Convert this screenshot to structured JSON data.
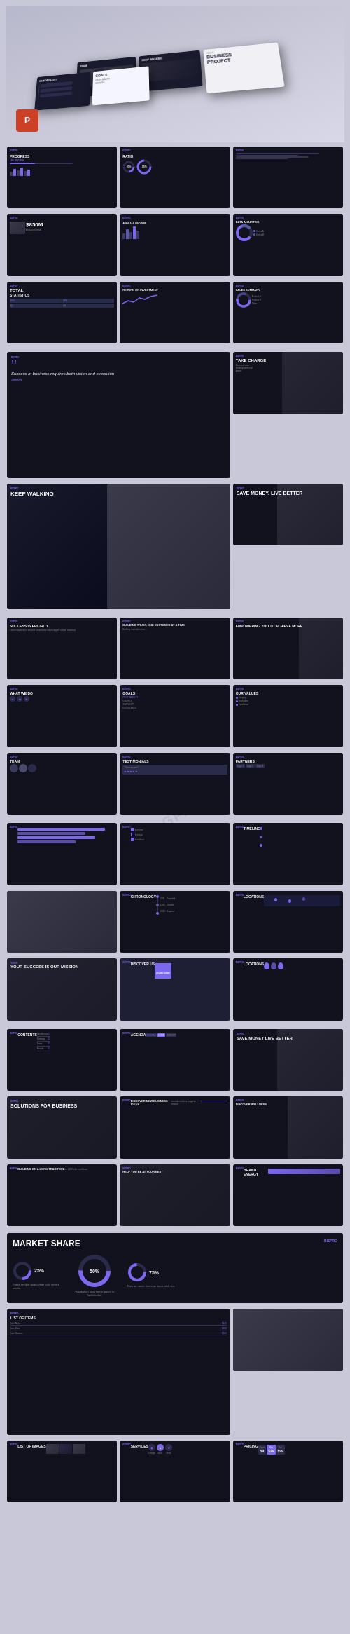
{
  "header": {
    "perspective_slides": [
      {
        "label": "TEAM",
        "type": "dark"
      },
      {
        "label": "KEEP WALKING",
        "type": "dark"
      },
      {
        "label": "YOUR BUSINESS PROJECT",
        "type": "dark"
      },
      {
        "label": "CHRONOLOGY",
        "type": "dark"
      },
      {
        "label": "GOALS",
        "type": "dark"
      },
      {
        "label": "GROWTH",
        "type": "white"
      }
    ],
    "ppt_icon": "P"
  },
  "row1": [
    {
      "id": "progress",
      "title": "PROGRESS",
      "subtitle": "10% GROWTH",
      "logo": "BIZPRO"
    },
    {
      "id": "ratio",
      "title": "RATIO",
      "value1": "25%",
      "value2": "75%",
      "logo": "BIZPRO"
    },
    {
      "id": "blank1",
      "title": "",
      "logo": "BIZPRO"
    }
  ],
  "row2": [
    {
      "id": "850m",
      "title": "$850M",
      "logo": "BIZPRO"
    },
    {
      "id": "annual_income",
      "title": "ANNUAL INCOME",
      "logo": "BIZPRO"
    },
    {
      "id": "data_analytics",
      "title": "DATA ANALYTICS",
      "logo": "BIZPRO"
    }
  ],
  "row3": [
    {
      "id": "total_statistics",
      "title": "TOTAL",
      "subtitle": "STATISTICS",
      "logo": "BIZPRO"
    },
    {
      "id": "return_investment",
      "title": "RETURN ON INVESTMENT",
      "logo": "BIZPRO"
    },
    {
      "id": "sales_summary",
      "title": "SALES SUMMARY",
      "logo": "BIZPRO"
    }
  ],
  "row4": [
    {
      "id": "quote_slide",
      "quote": "Success in business requires both vision and execution",
      "author": "JOHN DOE",
      "logo": "BIZPRO"
    },
    {
      "id": "take_charge",
      "title": "TAKE CHARGE",
      "logo": "BIZPRO"
    }
  ],
  "row5": [
    {
      "id": "keep_walking",
      "title": "KEEP WALKING",
      "logo": "BIZPRO"
    },
    {
      "id": "save_money",
      "title": "SAVE MONEY. LIVE BETTER",
      "logo": "BIZPRO"
    }
  ],
  "row6": [
    {
      "id": "success_priority",
      "title": "SUCCESS IS PRIORITY",
      "logo": "BIZPRO"
    },
    {
      "id": "building_trust",
      "title": "BUILDING TRUST, ONE CUSTOMER AT A TIME",
      "logo": "BIZPRO"
    },
    {
      "id": "empowering",
      "title": "EMPOWERING YOU TO ACHIEVE MORE",
      "logo": "BIZPRO"
    }
  ],
  "row7": [
    {
      "id": "what_we_do",
      "title": "WHAT WE DO",
      "logo": "BIZPRO"
    },
    {
      "id": "goals",
      "title": "GOALS",
      "items": [
        "PROFITABILITY",
        "GROWTH",
        "SIMPLICITY",
        "EXCELLENCE"
      ],
      "logo": "BIZPRO"
    },
    {
      "id": "our_values",
      "title": "OUR VALUES",
      "logo": "BIZPRO"
    }
  ],
  "row8": [
    {
      "id": "team",
      "title": "TEAM",
      "logo": "BIZPRO"
    },
    {
      "id": "testimonials",
      "title": "TESTIMONIALS",
      "logo": "BIZPRO"
    },
    {
      "id": "partners",
      "title": "PARTNERS",
      "logo": "BIZPRO"
    }
  ],
  "row9": [
    {
      "id": "purple_bars",
      "title": "",
      "logo": "BIZPRO"
    },
    {
      "id": "checklist",
      "title": "",
      "logo": "BIZPRO"
    },
    {
      "id": "timeline",
      "title": "TIMELINE",
      "logo": "BIZPRO"
    }
  ],
  "row10": [
    {
      "id": "chess",
      "title": "",
      "logo": "BIZPRO"
    },
    {
      "id": "chronology",
      "title": "CHRONOLOGY",
      "logo": "BIZPRO"
    },
    {
      "id": "locations_right",
      "title": "LOCATIONS",
      "logo": "BIZPRO"
    }
  ],
  "row11": [
    {
      "id": "your_success",
      "title": "YOUR SUCCESS IS OUR MISSION",
      "logo": "BIZPRO"
    },
    {
      "id": "discover_us",
      "title": "DISCOVER US",
      "logo": "BIZPRO"
    },
    {
      "id": "locations2",
      "title": "LOCATIONS",
      "logo": "BIZPRO"
    }
  ],
  "row12": [
    {
      "id": "contents",
      "title": "CONTENTS",
      "items": [
        "Introduction",
        "Strategy",
        "Team",
        "Results"
      ],
      "logo": "BIZPRO"
    },
    {
      "id": "agenda",
      "title": "AGENDA",
      "items": [
        "SEMINAR",
        "CONFERENCE",
        "WORKSHOP"
      ],
      "logo": "BIZPRO"
    },
    {
      "id": "save_money2",
      "title": "SAVE MONEY LIVE BETTER",
      "logo": "BIZPRO"
    }
  ],
  "row13": [
    {
      "id": "solutions",
      "title": "SOLUTIONS FOR BUSINESS",
      "logo": "BIZPRO"
    },
    {
      "id": "discover_new",
      "title": "DISCOVER NEW BUSINESS IDEAS",
      "logo": "BIZPRO"
    },
    {
      "id": "discover_wellness",
      "title": "DISCOVER WELLNESS",
      "logo": "BIZPRO"
    }
  ],
  "row14": [
    {
      "id": "long_tradition",
      "title": "BUILDING ON A LONG TRADITION",
      "logo": "BIZPRO"
    },
    {
      "id": "help_best",
      "title": "HELP YOU BE AT YOUR BEST",
      "logo": "BIZPRO"
    },
    {
      "id": "brand_energy",
      "title": "BRAND ENERGY",
      "logo": "BIZPRO"
    }
  ],
  "market_share": {
    "title": "MARKET SHARE",
    "logo": "BIZPRO",
    "values": [
      "25%",
      "50%",
      "75%"
    ],
    "center_value": "50%",
    "label1": "Fusce tempor quam vitae odio viverra mattis.",
    "label2": "Vestibulum bibis lorem ipsum in facilisis dui.",
    "label3": "Duis ac ormet lorem ac lacus nibh dui."
  },
  "row_bottom1": [
    {
      "id": "list_of_items",
      "title": "LIST OF ITEMS",
      "logo": "BIZPRO"
    },
    {
      "id": "photo_right",
      "title": "",
      "logo": "BIZPRO"
    }
  ],
  "row_bottom2": [
    {
      "id": "list_of_images",
      "title": "LIST OF IMAGES",
      "logo": "BIZPRO"
    },
    {
      "id": "services",
      "title": "SERVICES",
      "logo": "BIZPRO"
    },
    {
      "id": "pricing",
      "title": "PRICING",
      "logo": "BIZPRO"
    }
  ],
  "watermark": "AVAX.GFX.COM",
  "colors": {
    "dark_bg": "#12121e",
    "slide_bg": "#1a1a2e",
    "accent": "#7b68ee",
    "text_primary": "#ffffff",
    "text_secondary": "#888899",
    "body_bg": "#c8c8d8"
  }
}
